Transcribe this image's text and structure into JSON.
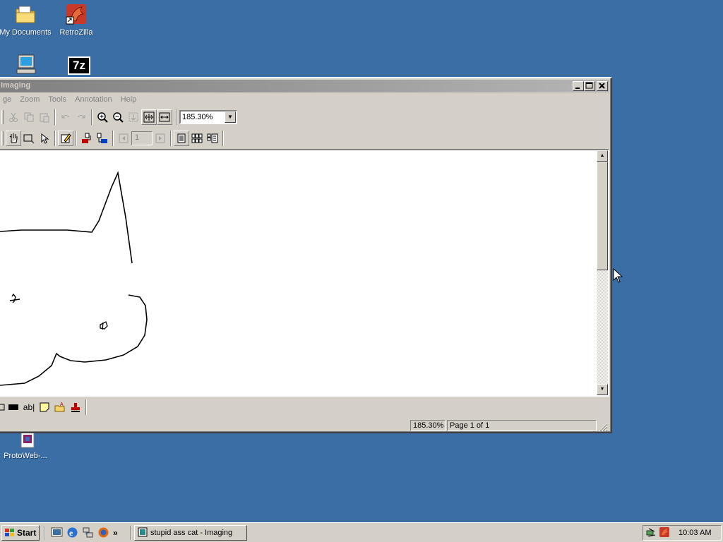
{
  "desktop": {
    "icons": [
      {
        "label": "My Documents",
        "icon": "my-documents-folder-icon"
      },
      {
        "label": "RetroZilla",
        "icon": "retrozilla-dragon-icon"
      },
      {
        "label": "",
        "icon": "my-computer-icon"
      },
      {
        "label": "",
        "icon": "7zip-icon",
        "glyph": "7z"
      },
      {
        "label": "ProtoWeb-...",
        "icon": "protoweb-shortcut-icon"
      }
    ]
  },
  "window": {
    "title": "Imaging",
    "menu": [
      "ge",
      "Zoom",
      "Tools",
      "Annotation",
      "Help"
    ],
    "zoom_value": "185.30%",
    "page_field": "1",
    "status": {
      "zoom": "185.30%",
      "page": "Page 1 of 1"
    },
    "anno_text_tool": "ab|"
  },
  "taskbar": {
    "start_label": "Start",
    "task_label": "stupid ass cat - Imaging",
    "clock": "10:03 AM",
    "quicklaunch_more": "»"
  }
}
